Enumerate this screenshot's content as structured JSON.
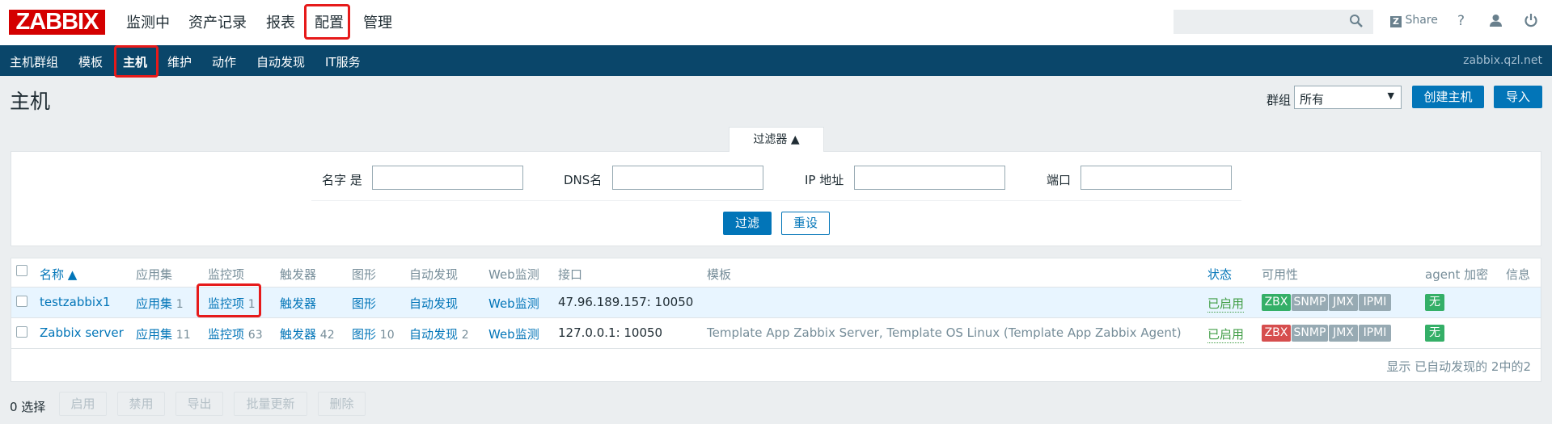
{
  "logo": "ZABBIX",
  "top_menu": [
    "监测中",
    "资产记录",
    "报表",
    "配置",
    "管理"
  ],
  "header": {
    "share": "Share",
    "help": "?",
    "colors": {
      "logo_red": "#d40000",
      "nav_blue": "#0a466a",
      "accent": "#0275b8",
      "highlight_box": "#e61a1a"
    }
  },
  "nav": {
    "items": [
      "主机群组",
      "模板",
      "主机",
      "维护",
      "动作",
      "自动发现",
      "IT服务"
    ],
    "server": "zabbix.qzl.net"
  },
  "page": {
    "title": "主机",
    "group_label": "群组",
    "group_value": "所有",
    "create_button": "创建主机",
    "import_button": "导入"
  },
  "filter": {
    "tab": "过滤器 ▲",
    "name_label": "名字 是",
    "dns_label": "DNS名",
    "ip_label": "IP 地址",
    "port_label": "端口",
    "apply": "过滤",
    "reset": "重设"
  },
  "table": {
    "headers": {
      "name": "名称 ▲",
      "apps": "应用集",
      "items": "监控项",
      "triggers": "触发器",
      "graphs": "图形",
      "discovery": "自动发现",
      "web": "Web监测",
      "interface": "接口",
      "templates": "模板",
      "status": "状态",
      "availability": "可用性",
      "encryption": "agent 加密",
      "info": "信息"
    },
    "rows": [
      {
        "name": "testzabbix1",
        "apps": "应用集",
        "apps_count": "1",
        "items": "监控项",
        "items_count": "1",
        "triggers": "触发器",
        "triggers_count": "",
        "graphs": "图形",
        "graphs_count": "",
        "discovery": "自动发现",
        "discovery_count": "",
        "web": "Web监测",
        "interface": "47.96.189.157: 10050",
        "templates": [],
        "status": "已启用",
        "zbx": "ZBX",
        "snmp": "SNMP",
        "jmx": "JMX",
        "ipmi": "IPMI",
        "encryption": "无"
      },
      {
        "name": "Zabbix server",
        "apps": "应用集",
        "apps_count": "11",
        "items": "监控项",
        "items_count": "63",
        "triggers": "触发器",
        "triggers_count": "42",
        "graphs": "图形",
        "graphs_count": "10",
        "discovery": "自动发现",
        "discovery_count": "2",
        "web": "Web监测",
        "interface": "127.0.0.1: 10050",
        "templates": [
          "Template App Zabbix Server",
          "Template OS Linux",
          "Template App Zabbix Agent"
        ],
        "status": "已启用",
        "zbx": "ZBX",
        "snmp": "SNMP",
        "jmx": "JMX",
        "ipmi": "IPMI",
        "encryption": "无"
      }
    ],
    "footer": "显示 已自动发现的 2中的2"
  },
  "bottom": {
    "selected": "0 选择",
    "enable": "启用",
    "disable": "禁用",
    "export": "导出",
    "mass_update": "批量更新",
    "delete": "删除"
  }
}
